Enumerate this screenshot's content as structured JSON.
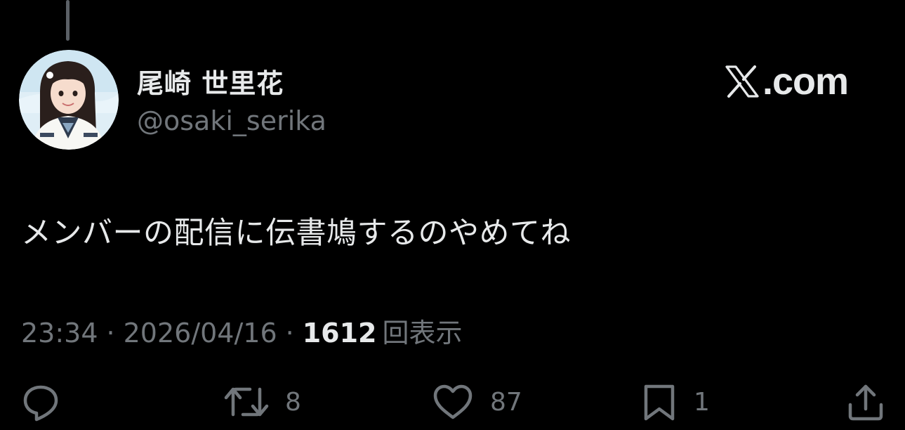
{
  "header": {
    "display_name": "尾崎 世里花",
    "handle": "@osaki_serika",
    "brand_text": ".com"
  },
  "tweet": {
    "text": "メンバーの配信に伝書鳩するのやめてね"
  },
  "meta": {
    "time": "23:34",
    "separator": "·",
    "date": "2026/04/16",
    "views_count": "1612",
    "views_label": "回表示"
  },
  "actions": {
    "reply_icon": "reply-icon",
    "retweet_icon": "retweet-icon",
    "retweet_count": "8",
    "like_icon": "heart-icon",
    "like_count": "87",
    "bookmark_icon": "bookmark-icon",
    "bookmark_count": "1",
    "share_icon": "share-icon"
  },
  "colors": {
    "background": "#000000",
    "primary_text": "#e7e9ea",
    "secondary_text": "#71767b"
  }
}
